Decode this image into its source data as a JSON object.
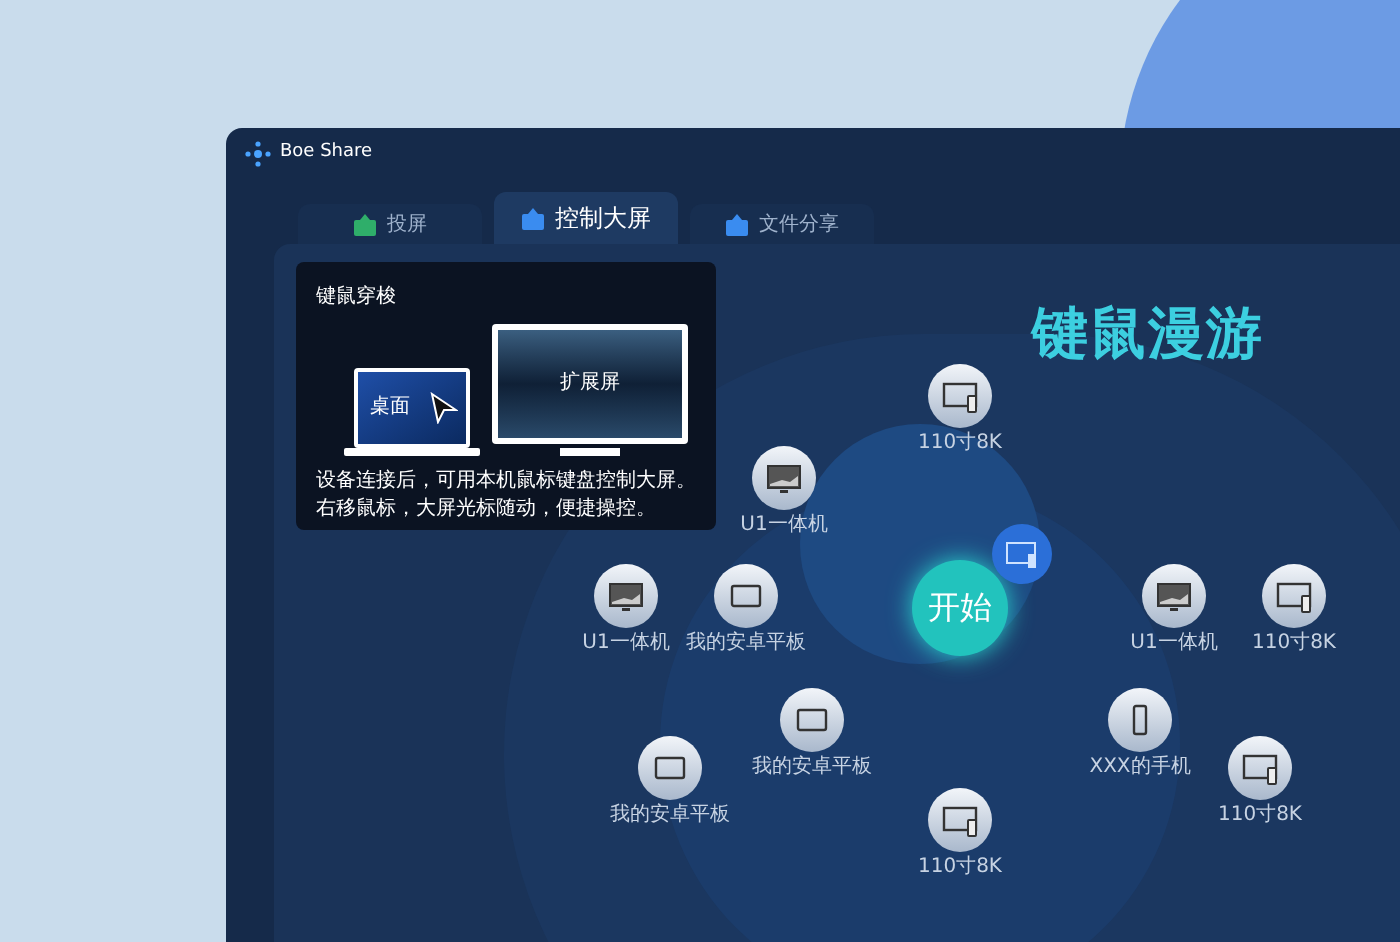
{
  "app": {
    "title": "Boe Share"
  },
  "tabs": [
    {
      "label": "投屏",
      "selected": false
    },
    {
      "label": "控制大屏",
      "selected": true
    },
    {
      "label": "文件分享",
      "selected": false
    }
  ],
  "info_card": {
    "title": "键鼠穿梭",
    "laptop_label": "桌面",
    "screen_label": "扩展屏",
    "description": "设备连接后，可用本机鼠标键盘控制大屏。右移鼠标，大屏光标随动，便捷操控。"
  },
  "headline": "键鼠漫游",
  "start_button": "开始",
  "devices": [
    {
      "name": "110寸8K",
      "kind": "tv"
    },
    {
      "name": "U1一体机",
      "kind": "monitor"
    },
    {
      "name": "U1一体机",
      "kind": "monitor"
    },
    {
      "name": "我的安卓平板",
      "kind": "tablet"
    },
    {
      "name": "我的安卓平板",
      "kind": "tablet"
    },
    {
      "name": "我的安卓平板",
      "kind": "tablet"
    },
    {
      "name": "110寸8K",
      "kind": "tv"
    },
    {
      "name": "U1一体机",
      "kind": "monitor"
    },
    {
      "name": "110寸8K",
      "kind": "tv"
    },
    {
      "name": "XXX的手机",
      "kind": "phone"
    },
    {
      "name": "110寸8K",
      "kind": "tv"
    }
  ]
}
